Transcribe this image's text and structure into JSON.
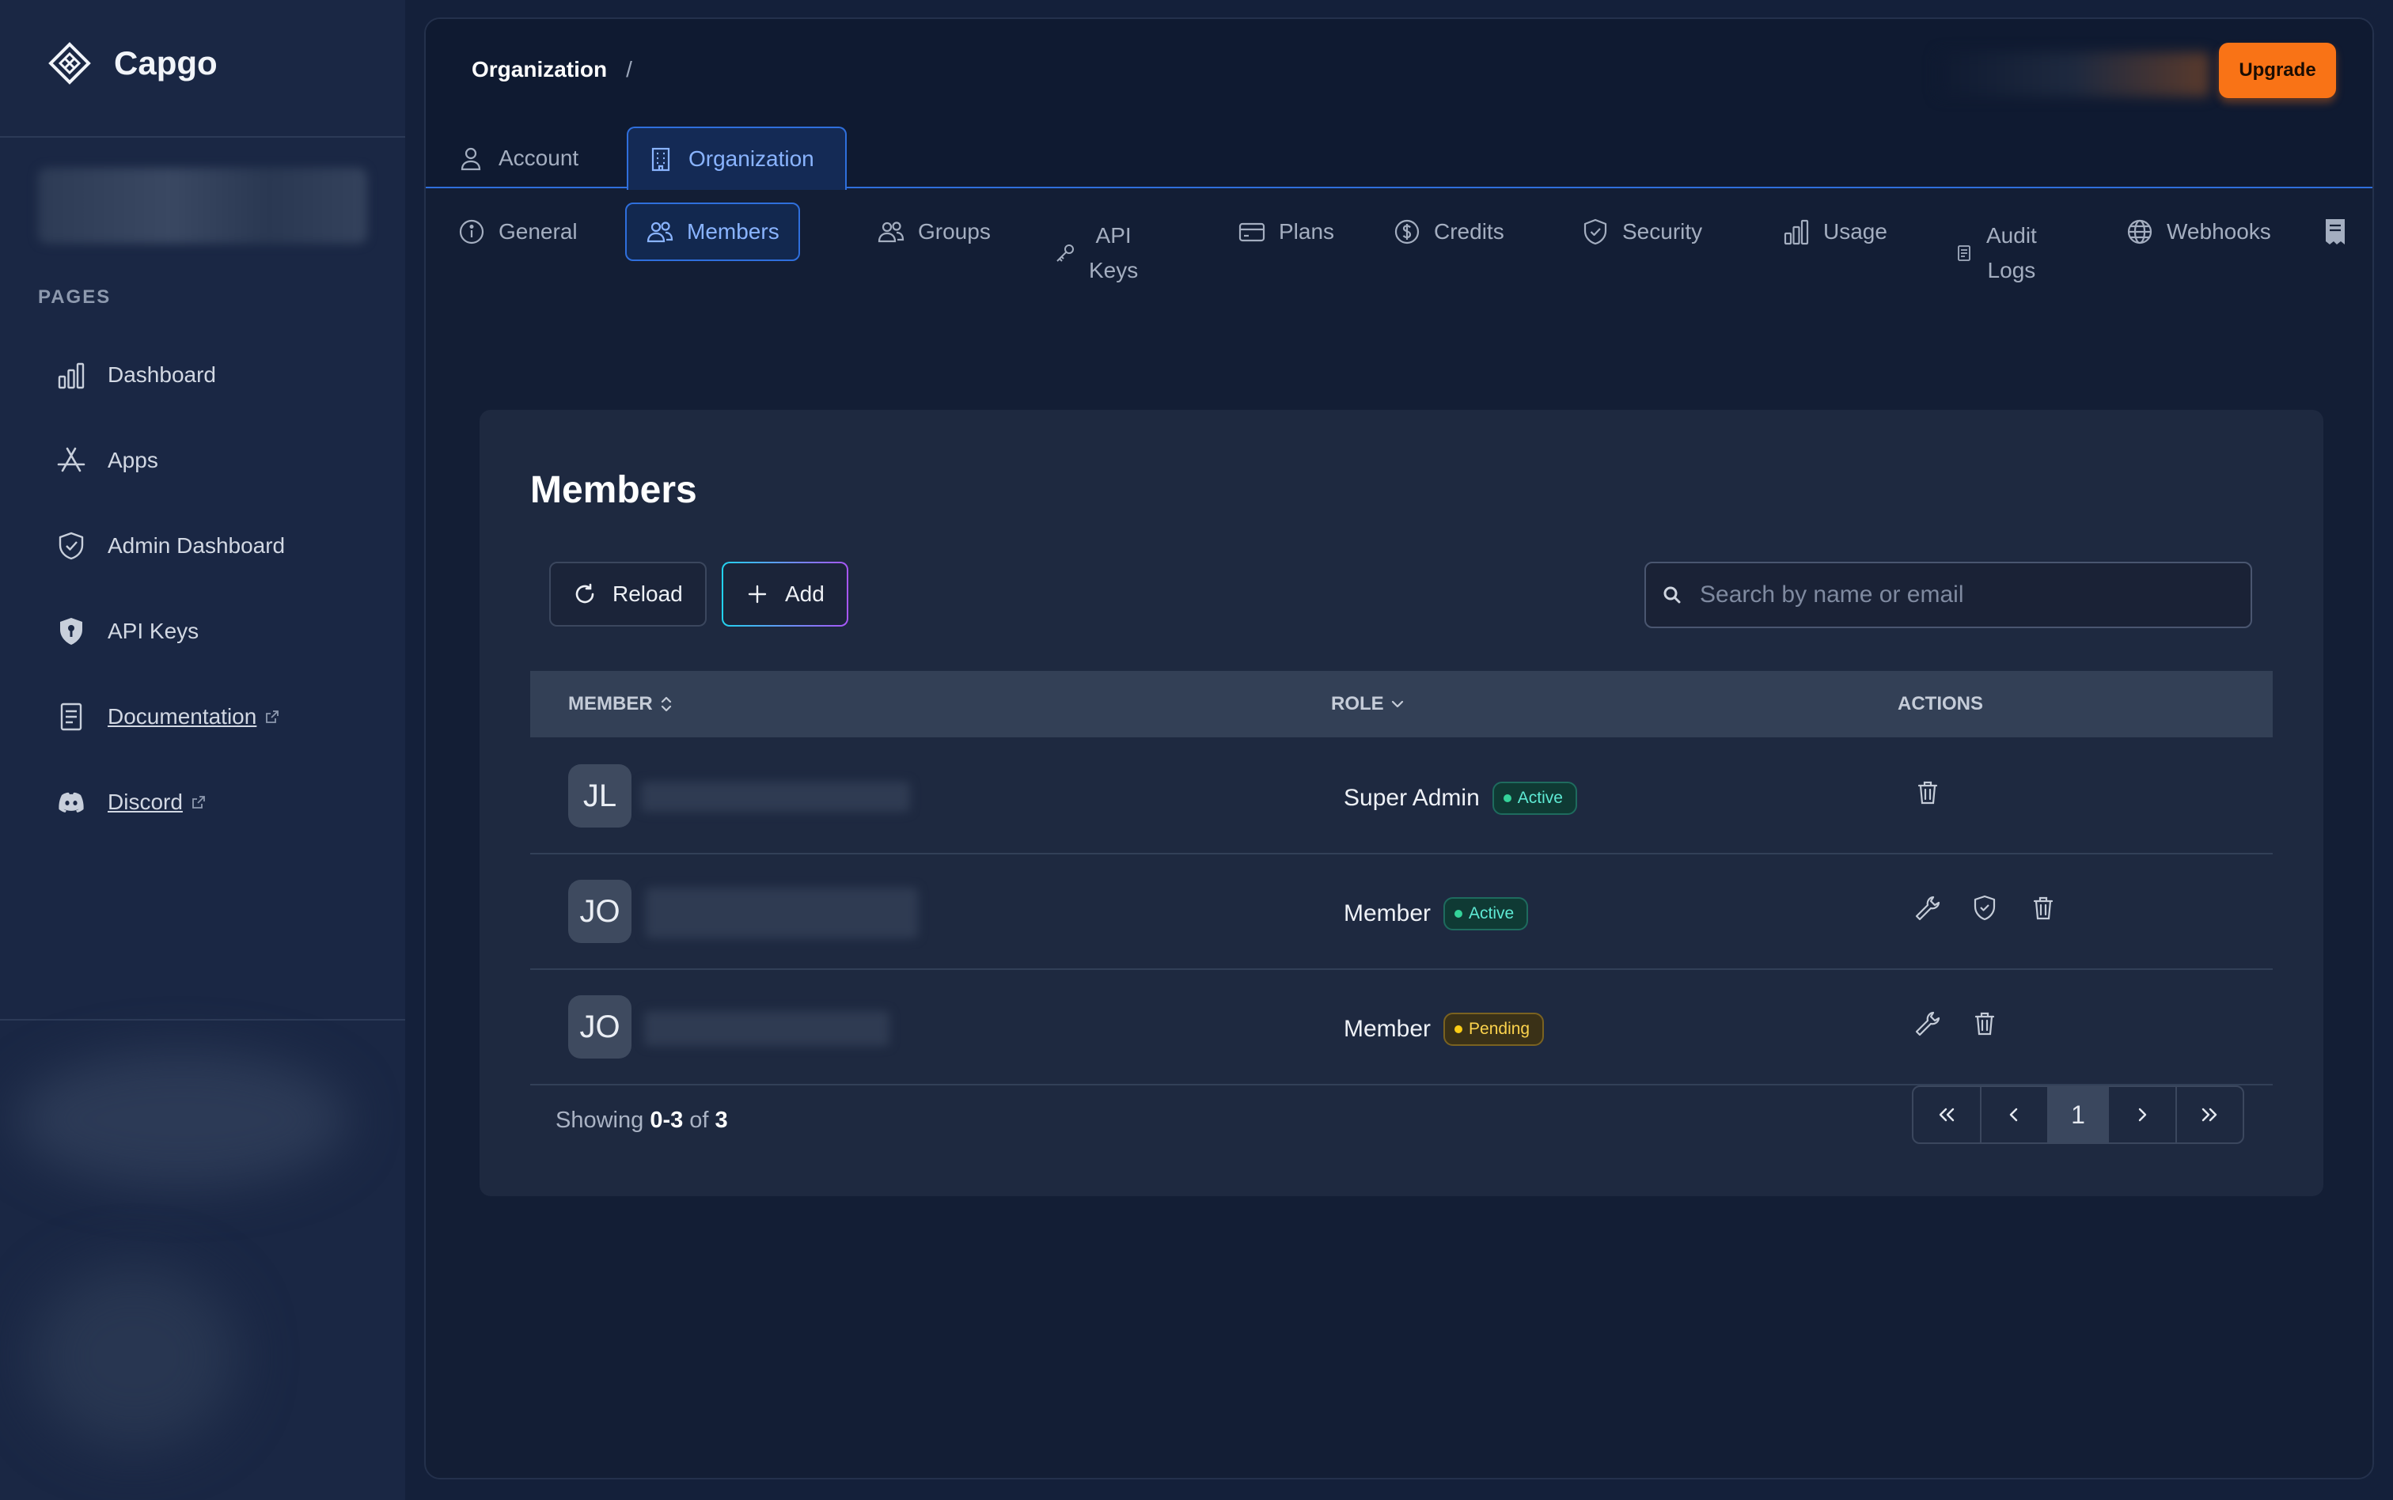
{
  "app": {
    "name": "Capgo"
  },
  "sidebar": {
    "pages_label": "PAGES",
    "items": [
      {
        "label": "Dashboard",
        "icon": "bar-chart-icon"
      },
      {
        "label": "Apps",
        "icon": "app-store-icon"
      },
      {
        "label": "Admin Dashboard",
        "icon": "shield-check-icon"
      },
      {
        "label": "API Keys",
        "icon": "shield-key-icon"
      },
      {
        "label": "Documentation",
        "icon": "document-icon",
        "external": true
      },
      {
        "label": "Discord",
        "icon": "discord-icon",
        "external": true
      }
    ]
  },
  "header": {
    "breadcrumb": [
      "Organization",
      "/"
    ],
    "upgrade_label": "Upgrade"
  },
  "top_tabs": [
    {
      "label": "Account",
      "icon": "user-icon",
      "active": false
    },
    {
      "label": "Organization",
      "icon": "building-icon",
      "active": true
    }
  ],
  "sub_tabs": [
    {
      "label": "General",
      "icon": "info-icon"
    },
    {
      "label": "Members",
      "icon": "users-icon",
      "active": true
    },
    {
      "label": "Groups",
      "icon": "users-icon"
    },
    {
      "label": "API Keys",
      "line1": "API",
      "line2": "Keys",
      "icon": "key-icon"
    },
    {
      "label": "Plans",
      "icon": "credit-card-icon"
    },
    {
      "label": "Credits",
      "icon": "dollar-icon"
    },
    {
      "label": "Security",
      "icon": "shield-icon"
    },
    {
      "label": "Usage",
      "icon": "bar-chart-icon"
    },
    {
      "label": "Audit Logs",
      "line1": "Audit",
      "line2": "Logs",
      "icon": "log-icon"
    },
    {
      "label": "Webhooks",
      "icon": "globe-icon"
    }
  ],
  "members": {
    "title": "Members",
    "reload_label": "Reload",
    "add_label": "Add",
    "search_placeholder": "Search by name or email",
    "columns": {
      "member": "MEMBER",
      "role": "ROLE",
      "actions": "ACTIONS"
    },
    "rows": [
      {
        "initials": "JL",
        "role": "Super Admin",
        "status": "Active",
        "actions": [
          "delete"
        ]
      },
      {
        "initials": "JO",
        "role": "Member",
        "status": "Active",
        "actions": [
          "edit",
          "permissions",
          "delete"
        ]
      },
      {
        "initials": "JO",
        "role": "Member",
        "status": "Pending",
        "actions": [
          "edit",
          "delete"
        ]
      }
    ],
    "footer": {
      "showing_prefix": "Showing",
      "range": "0-3",
      "of_word": "of",
      "total": "3"
    },
    "pagination": {
      "current_page": "1"
    }
  },
  "colors": {
    "accent": "#2f6fdc",
    "upgrade": "#f97316",
    "active_badge": "#34d399",
    "pending_badge": "#facc15"
  }
}
